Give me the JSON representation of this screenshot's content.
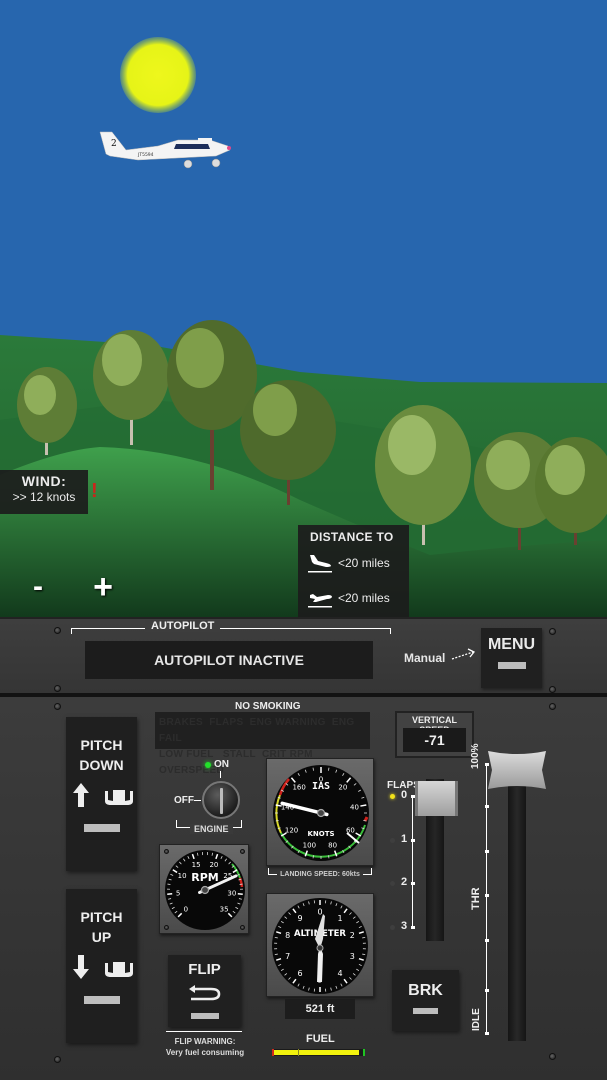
{
  "scene": {
    "colors": {
      "sky": "#2766ae",
      "sun": "#e8f51a",
      "hill_far": "#2a7a3c",
      "hill_near": "#3a9a48"
    },
    "aircraft": {
      "tail_number": "2",
      "registration": "JT5594"
    }
  },
  "hud": {
    "wind": {
      "title": "WIND:",
      "value": ">> 12 knots",
      "warning": "!"
    },
    "distance": {
      "title": "DISTANCE TO",
      "landing": {
        "icon": "plane-landing-icon",
        "value": "<20 miles"
      },
      "takeoff": {
        "icon": "plane-takeoff-icon",
        "value": "<20 miles"
      }
    },
    "zoom_out_label": "-",
    "zoom_in_label": "+"
  },
  "autopilot": {
    "section_label": "AUTOPILOT",
    "status": "AUTOPILOT INACTIVE",
    "manual_label": "Manual",
    "menu_label": "MENU"
  },
  "panel": {
    "pitch_down": {
      "line1": "PITCH",
      "line2": "DOWN",
      "arrow": "up"
    },
    "pitch_up": {
      "line1": "PITCH",
      "line2": "UP",
      "arrow": "down"
    },
    "no_smoking": "NO SMOKING",
    "annunciators": {
      "row1": [
        "BRAKES",
        "FLAPS",
        "ENG WARNING",
        "ENG FAIL"
      ],
      "row2": [
        "LOW FUEL",
        "STALL",
        "CRIT RPM",
        "OVERSPEED"
      ],
      "active": []
    },
    "vertical_speed": {
      "label": "VERTICAL SPEED",
      "value": "-71"
    },
    "engine": {
      "on_label": "ON",
      "off_label": "OFF",
      "label": "ENGINE",
      "state": "on"
    },
    "rpm_gauge": {
      "title": "RPM",
      "ticks": [
        "0",
        "5",
        "10",
        "15",
        "20",
        "25",
        "30",
        "35"
      ],
      "value": 26
    },
    "ias_gauge": {
      "title": "IAS",
      "unit": "KNOTS",
      "ticks": [
        "0",
        "20",
        "40",
        "60",
        "80",
        "100",
        "120",
        "140",
        "160"
      ],
      "value": 142,
      "landing_speed": "LANDING SPEED: 60kts"
    },
    "altimeter": {
      "title": "ALTIMETER",
      "ticks": [
        "0",
        "1",
        "2",
        "3",
        "4",
        "5",
        "6",
        "7",
        "8",
        "9"
      ],
      "readout": "521 ft"
    },
    "flip": {
      "label": "FLIP",
      "warning_line1": "FLIP WARNING:",
      "warning_line2": "Very fuel consuming"
    },
    "fuel": {
      "label": "FUEL",
      "level_percent": 96
    },
    "flaps": {
      "label": "FLAPS",
      "positions": [
        "0",
        "1",
        "2",
        "3"
      ],
      "selected": "0",
      "indicator_color": "#f2e21a"
    },
    "brake": {
      "label": "BRK"
    },
    "throttle": {
      "max_label": "100%",
      "label": "THR",
      "min_label": "IDLE",
      "level_percent": 100
    }
  }
}
